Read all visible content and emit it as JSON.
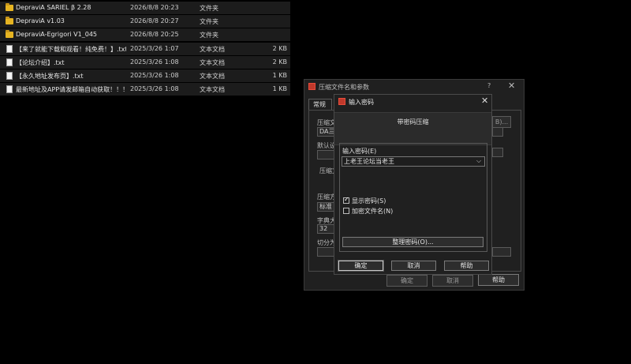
{
  "files": [
    {
      "name": "DepraviA SARIEL β 2.28",
      "date": "2026/8/8 20:23",
      "type": "文件夹",
      "size": "",
      "icon": "folder-icon"
    },
    {
      "name": "DepraviA v1.03",
      "date": "2026/8/8 20:27",
      "type": "文件夹",
      "size": "",
      "icon": "folder-icon"
    },
    {
      "name": "DepraviA-Egrigori V1_045",
      "date": "2026/8/8 20:25",
      "type": "文件夹",
      "size": "",
      "icon": "folder-icon"
    },
    {
      "name": "【来了就能下载和观看！纯免费！】.txt",
      "date": "2025/3/26 1:07",
      "type": "文本文档",
      "size": "2 KB",
      "icon": "text-file-icon"
    },
    {
      "name": "【论坛介绍】.txt",
      "date": "2025/3/26 1:08",
      "type": "文本文档",
      "size": "2 KB",
      "icon": "text-file-icon"
    },
    {
      "name": "【永久地址发布页】.txt",
      "date": "2025/3/26 1:08",
      "type": "文本文档",
      "size": "1 KB",
      "icon": "text-file-icon"
    },
    {
      "name": "最新地址及APP请发邮箱自动获取！！！...",
      "date": "2025/3/26 1:08",
      "type": "文本文档",
      "size": "1 KB",
      "icon": "text-file-icon"
    }
  ],
  "back_dialog": {
    "title": "压缩文件名和参数",
    "help": "?",
    "close": "✕",
    "tab": "常规",
    "archive_name_label": "压缩文",
    "archive_name_value": "DA三部",
    "browse_label": "B)...",
    "profile_label": "默认设",
    "format_label": "压缩文",
    "method_label": "压缩方",
    "method_value": "标准",
    "dict_label": "字典大",
    "dict_value": "32",
    "split_label": "切分为",
    "ok": "确定",
    "cancel": "取消",
    "help_btn": "帮助"
  },
  "pw_dialog": {
    "title": "输入密码",
    "close": "✕",
    "header": "带密码压缩",
    "prompt": "输入密码(E)",
    "password": "上老王论坛当老王",
    "show_password": "显示密码(S)",
    "show_password_checked": true,
    "encrypt_names": "加密文件名(N)",
    "encrypt_names_checked": false,
    "manage": "整理密码(O)...",
    "ok": "确定",
    "cancel": "取消",
    "help": "帮助"
  },
  "colors": {
    "folder": "#e6b422",
    "background": "#000000",
    "dialog": "#202020"
  }
}
